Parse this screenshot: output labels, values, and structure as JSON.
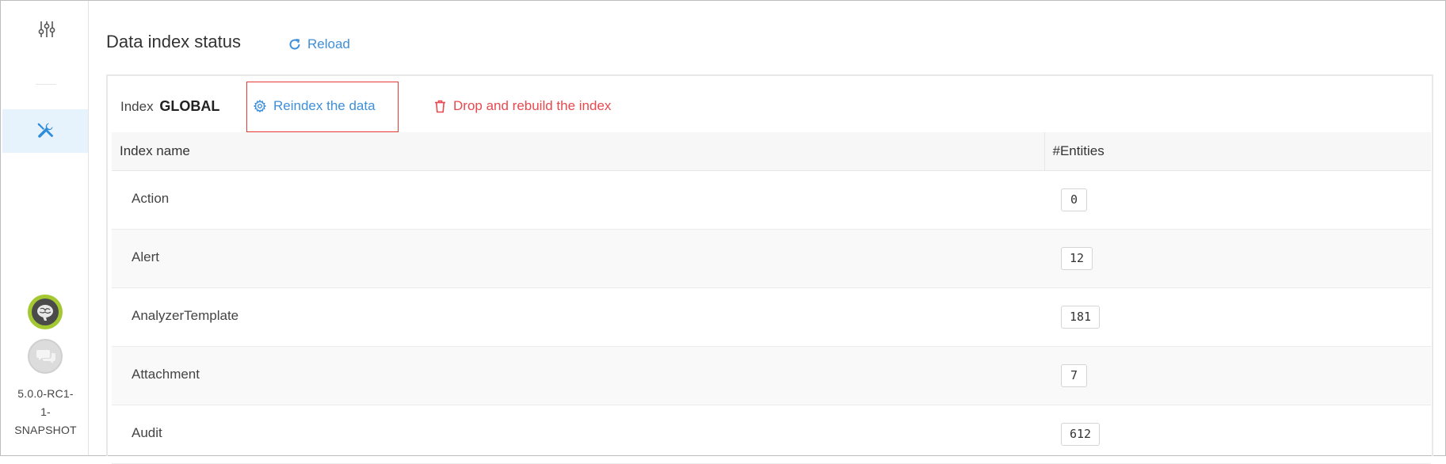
{
  "sidebar": {
    "top_icon": "settings-sliders-icon",
    "active_icon": "tools-icon",
    "brain_icon": "brain-icon",
    "chat_icon": "chat-icon",
    "version_lines": [
      "5.0.0-RC1-",
      "1-",
      "SNAPSHOT"
    ]
  },
  "header": {
    "title": "Data index status",
    "reload_label": "Reload"
  },
  "index": {
    "label": "Index",
    "name": "GLOBAL",
    "reindex_label": "Reindex the data",
    "drop_label": "Drop and rebuild the index"
  },
  "table": {
    "columns": [
      "Index name",
      "#Entities"
    ],
    "rows": [
      {
        "name": "Action",
        "count": "0"
      },
      {
        "name": "Alert",
        "count": "12"
      },
      {
        "name": "AnalyzerTemplate",
        "count": "181"
      },
      {
        "name": "Attachment",
        "count": "7"
      },
      {
        "name": "Audit",
        "count": "612"
      }
    ]
  },
  "colors": {
    "accent": "#3f8fd9",
    "danger": "#e8494f",
    "active_bg": "#e6f3fc",
    "avatar_ring": "#a3c832"
  }
}
